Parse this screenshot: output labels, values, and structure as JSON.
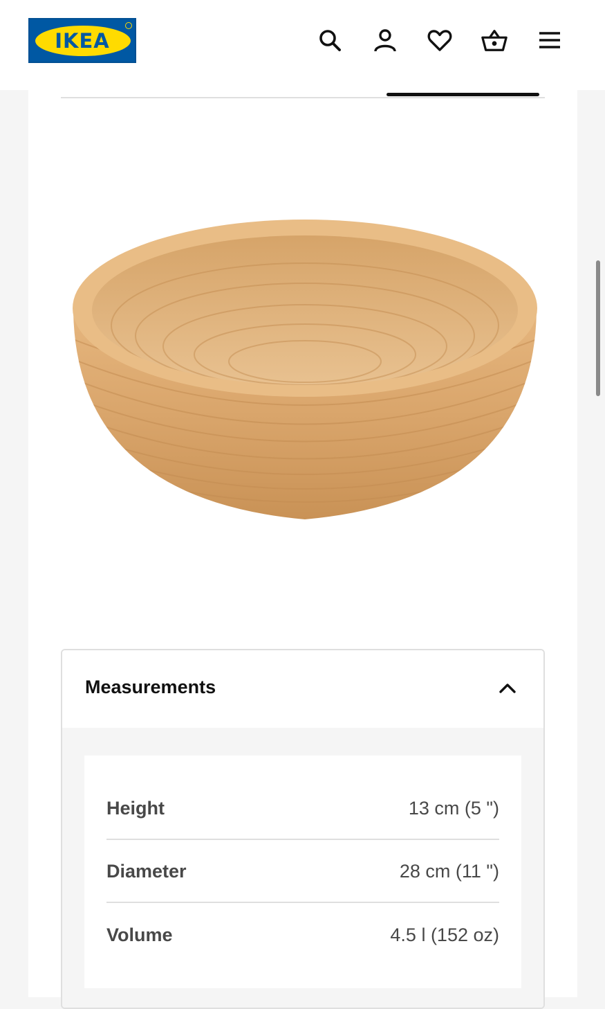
{
  "header": {
    "logo_text": "IKEA",
    "icons": [
      "search-icon",
      "user-icon",
      "heart-icon",
      "basket-icon",
      "menu-icon"
    ]
  },
  "product": {
    "image": "wooden-bowl"
  },
  "measurements": {
    "title": "Measurements",
    "rows": [
      {
        "label": "Height",
        "value": "13 cm (5 \")"
      },
      {
        "label": "Diameter",
        "value": "28 cm (11 \")"
      },
      {
        "label": "Volume",
        "value": "4.5 l (152 oz)"
      }
    ]
  },
  "colors": {
    "brand_blue": "#0058a3",
    "brand_yellow": "#ffdb00",
    "wood": "#d9a56b"
  }
}
